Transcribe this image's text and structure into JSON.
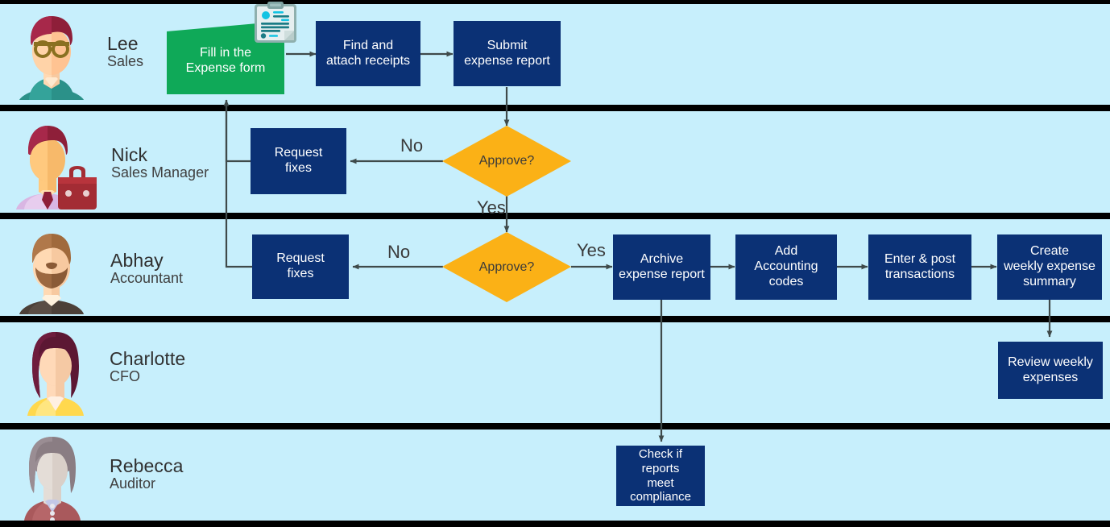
{
  "diagram": {
    "title": "Expense report approval swimlane process",
    "background_color": "#c7effc",
    "lane_divider_color": "#000000",
    "process_box_color": "#0b3175",
    "start_box_color": "#0fa958",
    "decision_color": "#fbb116",
    "connector_color": "#3f4a4a",
    "text_color": "#3a3a3a"
  },
  "lanes": [
    {
      "id": "lane-lee",
      "name": "Lee",
      "role": "Sales",
      "avatar": "male-glasses-avatar"
    },
    {
      "id": "lane-nick",
      "name": "Nick",
      "role": "Sales Manager",
      "avatar": "businessman-briefcase-avatar"
    },
    {
      "id": "lane-abhay",
      "name": "Abhay",
      "role": "Accountant",
      "avatar": "bearded-man-avatar"
    },
    {
      "id": "lane-charlotte",
      "name": "Charlotte",
      "role": "CFO",
      "avatar": "woman-long-hair-avatar"
    },
    {
      "id": "lane-rebecca",
      "name": "Rebecca",
      "role": "Auditor",
      "avatar": "woman-bob-hair-avatar"
    }
  ],
  "nodes": {
    "fill_expense_form": "Fill in the\nExpense form",
    "find_attach_receipts": "Find and\nattach receipts",
    "submit_expense_report": "Submit\nexpense report",
    "nick_request_fixes": "Request\nfixes",
    "nick_approve": "Approve?",
    "abhay_request_fixes": "Request\nfixes",
    "abhay_approve": "Approve?",
    "archive_expense_report": "Archive\nexpense report",
    "add_accounting_codes": "Add\nAccounting\ncodes",
    "enter_post_transactions": "Enter & post\ntransactions",
    "create_weekly_summary": "Create\nweekly expense\nsummary",
    "review_weekly_expenses": "Review weekly\nexpenses",
    "check_compliance": "Check if\nreports\nmeet\ncompliance"
  },
  "edge_labels": {
    "nick_no": "No",
    "nick_yes": "Yes",
    "abhay_no": "No",
    "abhay_yes": "Yes"
  },
  "icons": {
    "form_document": "clipboard-form-icon"
  }
}
